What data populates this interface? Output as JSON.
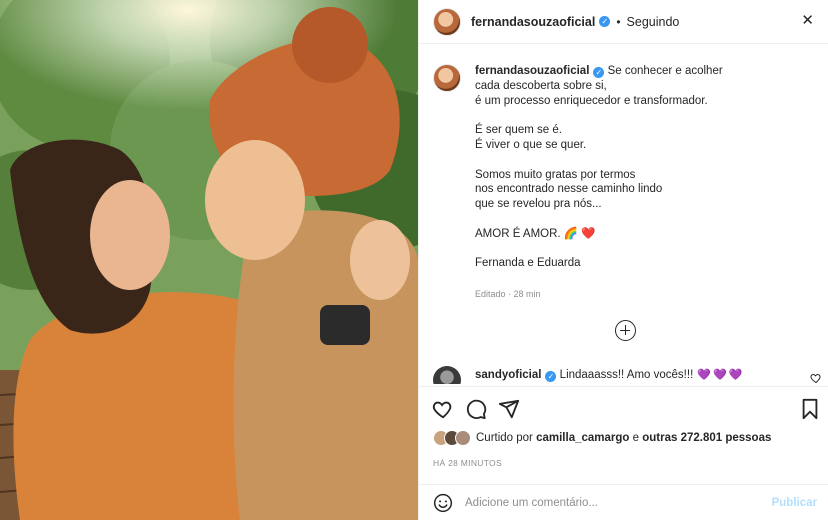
{
  "post": {
    "username": "fernandasouzaoficial",
    "verified_badge": "✓",
    "separator": "•",
    "follow_status": "Seguindo",
    "more_icon": "more-horizontal-icon",
    "caption": {
      "username": "fernandasouzaoficial",
      "text": "Se conhecer e acolher\ncada descoberta sobre si,\né um processo enriquecedor e transformador.\n\nÉ ser quem se é.\nÉ viver o que se quer.\n\nSomos muito gratas por termos\nnos encontrado nesse caminho lindo\nque se revelou pra nós...\n\nAMOR É AMOR. 🌈 ❤️\n\nFernanda e Eduarda"
    },
    "edited_label": "Editado · 28 min",
    "load_more_icon": "plus-circle-icon",
    "comment": {
      "username": "sandyoficial",
      "text": "Lindaaasss!! Amo vocês!!!",
      "hearts": "💜💜💜"
    },
    "likes_text_prefix": "Curtido por ",
    "likes_user": "camilla_camargo",
    "likes_text_middle": " e ",
    "likes_count": "outras 272.801 pessoas",
    "time_ago": "HÁ 28 MINUTOS",
    "add_comment_placeholder": "Adicione um comentário...",
    "publish_label": "Publicar"
  },
  "colors": {
    "verified": "#3897f0",
    "publish_disabled": "#b2dffc",
    "secondary_text": "#8e8e8e"
  }
}
